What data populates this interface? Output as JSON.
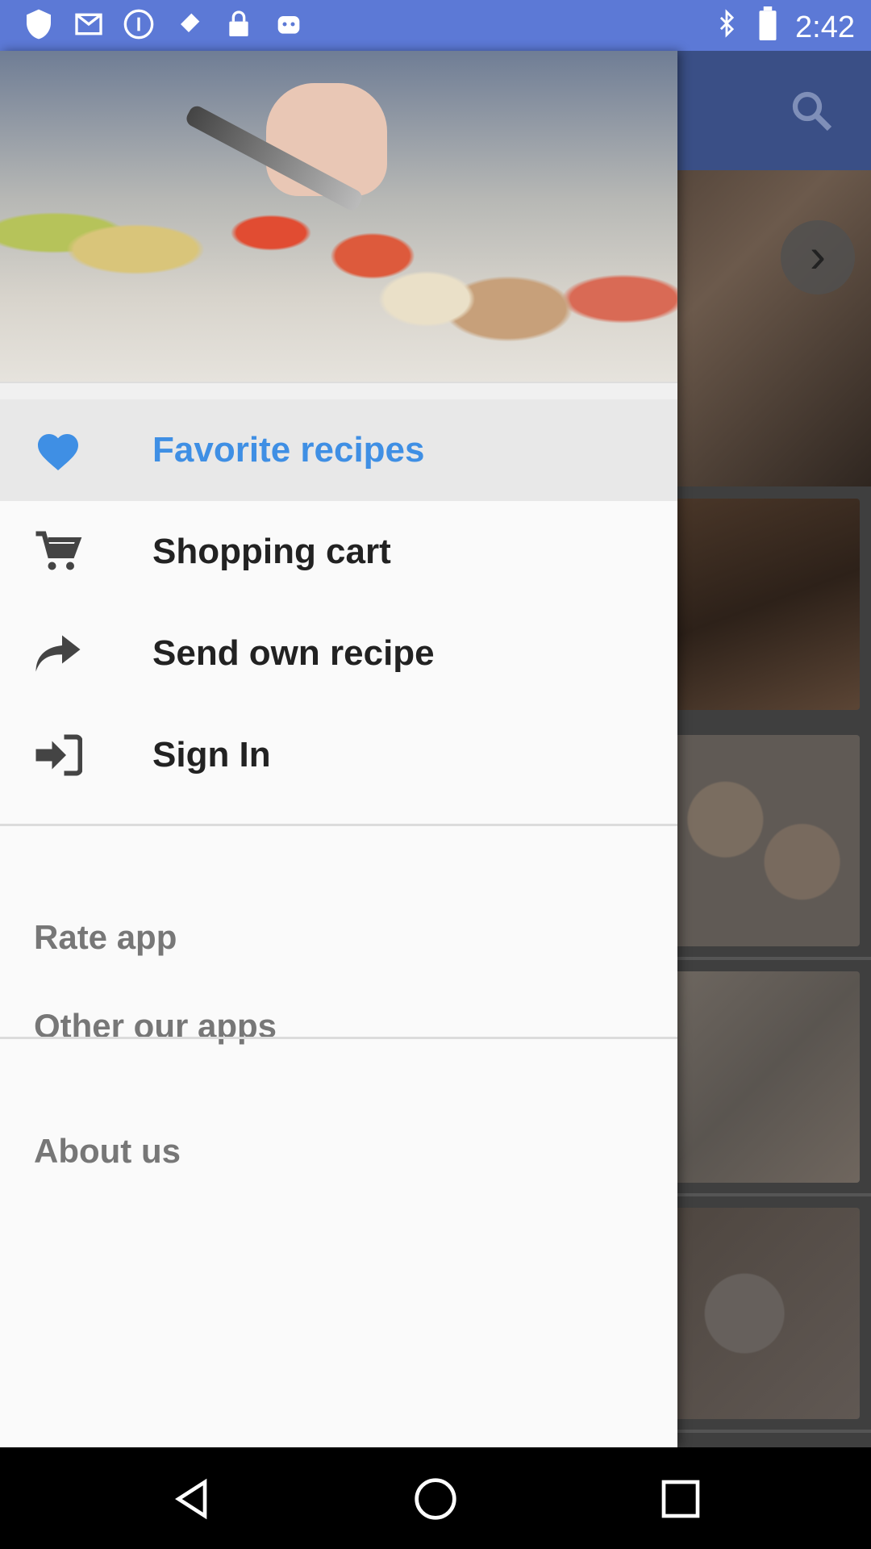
{
  "status_bar": {
    "time": "2:42",
    "icons": [
      "shield-icon",
      "mail-icon",
      "info-icon",
      "fake-gps-icon",
      "lock-icon",
      "android-icon",
      "bluetooth-icon",
      "battery-icon"
    ]
  },
  "drawer": {
    "items": [
      {
        "label": "Favorite recipes",
        "icon": "heart-icon",
        "active": true
      },
      {
        "label": "Shopping cart",
        "icon": "cart-icon",
        "active": false
      },
      {
        "label": "Send own recipe",
        "icon": "share-icon",
        "active": false
      },
      {
        "label": "Sign In",
        "icon": "sign-in-icon",
        "active": false
      }
    ],
    "secondary": {
      "rate_app": "Rate app",
      "other_apps": "Other our apps",
      "about_us": "About us"
    }
  },
  "colors": {
    "status_bar": "#5c79d6",
    "active_text": "#3f8fe4",
    "active_bg": "#e8e8e8"
  }
}
